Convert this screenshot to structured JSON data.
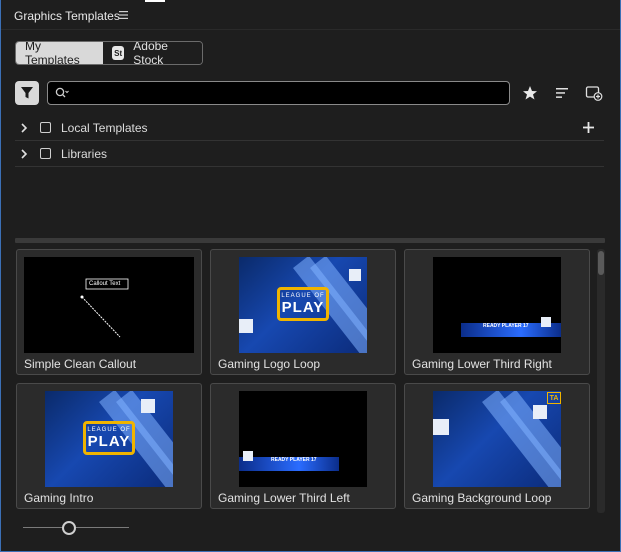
{
  "panel": {
    "title": "Graphics Templates"
  },
  "tabs": {
    "my_templates": "My Templates",
    "adobe_stock": "Adobe Stock",
    "stock_badge": "St"
  },
  "search": {
    "value": "",
    "placeholder": ""
  },
  "tree": [
    {
      "label": "Local Templates"
    },
    {
      "label": "Libraries"
    }
  ],
  "templates": [
    {
      "label": "Simple Clean Callout",
      "thumb_text": "Callout Text"
    },
    {
      "label": "Gaming Logo Loop",
      "thumb_small": "LEAGUE OF",
      "thumb_big": "PLAY"
    },
    {
      "label": "Gaming Lower Third Right",
      "thumb_text": "READY PLAYER 17"
    },
    {
      "label": "Gaming Intro",
      "thumb_small": "LEAGUE OF",
      "thumb_big": "PLAY"
    },
    {
      "label": "Gaming Lower Third Left",
      "thumb_text": "READY PLAYER 17"
    },
    {
      "label": "Gaming Background Loop",
      "badge": "TA"
    }
  ],
  "colors": {
    "accent_border": "#3b6fb5",
    "gaming_blue": "#1748b0",
    "gold": "#f0b400"
  },
  "thumbnail_size": {
    "level": 0.42
  }
}
